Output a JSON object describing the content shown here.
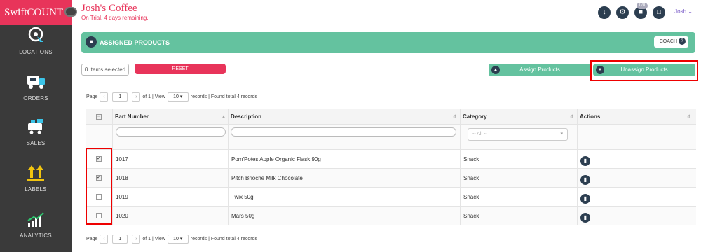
{
  "brand": "SwiftCOUNT",
  "nav": [
    {
      "label": "LOCATIONS",
      "icon": "location-icon"
    },
    {
      "label": "ORDERS",
      "icon": "truck-icon"
    },
    {
      "label": "SALES",
      "icon": "cart-icon"
    },
    {
      "label": "LABELS",
      "icon": "labels-icon"
    },
    {
      "label": "ANALYTICS",
      "icon": "chart-icon"
    }
  ],
  "header": {
    "company": "Josh's Coffee",
    "trial": "On Trial. 4 days remaining.",
    "badge": "0/0",
    "user": "Josh"
  },
  "banner": {
    "title": "ASSIGNED PRODUCTS",
    "coach_label": "COACH"
  },
  "toolbar": {
    "selected": "0 Items selected",
    "reset": "RESET",
    "assign": "Assign Products",
    "unassign": "Unassign Products"
  },
  "pager": {
    "page_label": "Page",
    "page": "1",
    "of_view": "of 1 | View",
    "per_page": "10",
    "records": "records | Found total 4 records"
  },
  "table": {
    "headers": [
      "Part Number",
      "Description",
      "Category",
      "Actions"
    ],
    "category_filter": "-- All --",
    "rows": [
      {
        "part": "1017",
        "desc": "Pom'Potes Apple Organic Flask 90g",
        "cat": "Snack",
        "checked": true
      },
      {
        "part": "1018",
        "desc": "Pitch Brioche Milk Chocolate",
        "cat": "Snack",
        "checked": true
      },
      {
        "part": "1019",
        "desc": "Twix 50g",
        "cat": "Snack",
        "checked": false
      },
      {
        "part": "1020",
        "desc": "Mars 50g",
        "cat": "Snack",
        "checked": false
      }
    ]
  },
  "colors": {
    "brand": "#e8345a",
    "accent": "#64c29f",
    "sidebar": "#3a3a3a",
    "icon": "#2c3e50"
  }
}
